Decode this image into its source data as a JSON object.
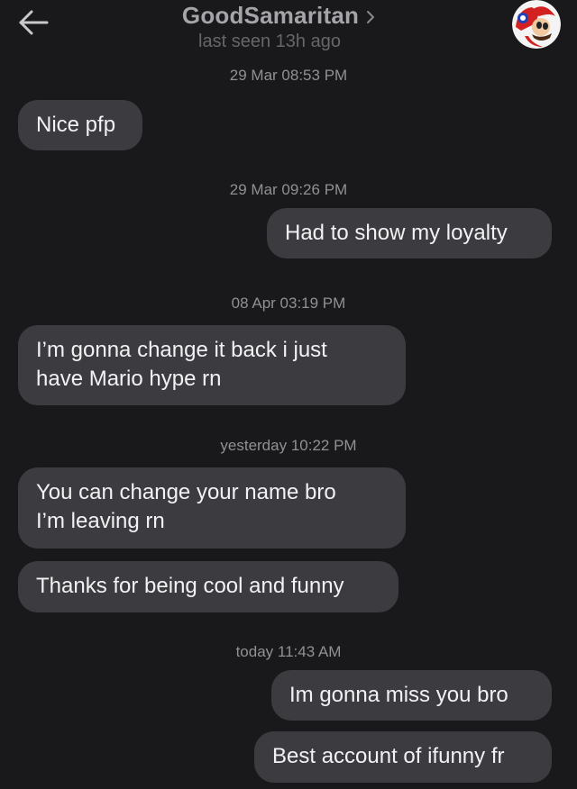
{
  "header": {
    "title": "GoodSamaritan",
    "subtitle": "last seen 13h ago",
    "icons": {
      "back": "back-arrow-icon",
      "chevron": "chevron-right-icon",
      "avatar": "mario-avatar"
    }
  },
  "colors": {
    "background": "#19191b",
    "bubble": "#3c3c40",
    "title": "#a4a4a9",
    "timestamp": "#909095"
  },
  "messages": {
    "t1": "29 Mar 08:53 PM",
    "m1": "Nice pfp",
    "t2": "29 Mar 09:26 PM",
    "m2": "Had to show my loyalty",
    "t3": "08 Apr 03:19 PM",
    "m3": "I’m gonna change it back i just\nhave Mario hype rn",
    "t4": "yesterday 10:22 PM",
    "m4": "You can change your name bro\nI’m leaving rn",
    "m5": "Thanks for being cool and funny",
    "t5": "today 11:43 AM",
    "m6": "Im gonna miss you bro",
    "m7": "Best account of ifunny fr"
  }
}
